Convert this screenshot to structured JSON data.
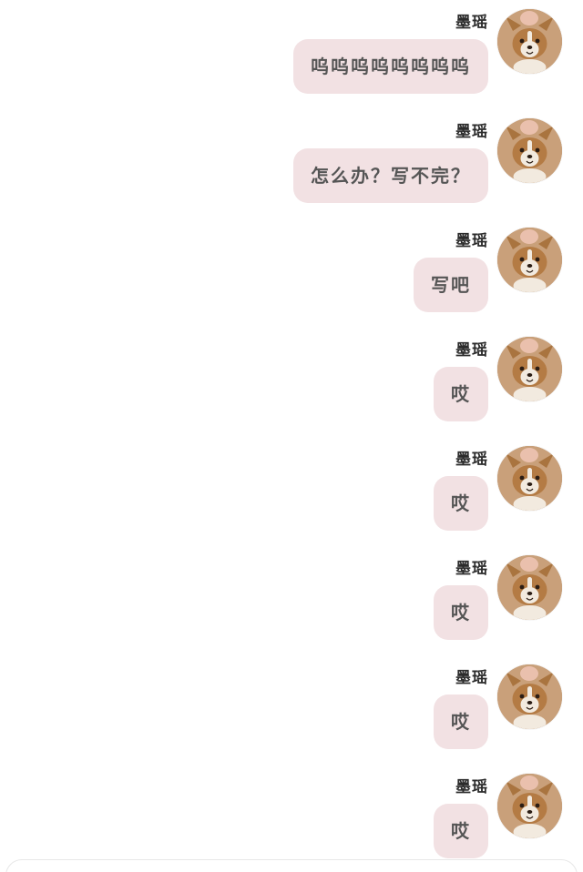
{
  "chat": {
    "messages": [
      {
        "sender": "墨瑶",
        "text": "呜呜呜呜呜呜呜呜"
      },
      {
        "sender": "墨瑶",
        "text": "怎么办？写不完？"
      },
      {
        "sender": "墨瑶",
        "text": "写吧"
      },
      {
        "sender": "墨瑶",
        "text": "哎"
      },
      {
        "sender": "墨瑶",
        "text": "哎"
      },
      {
        "sender": "墨瑶",
        "text": "哎"
      },
      {
        "sender": "墨瑶",
        "text": "哎"
      },
      {
        "sender": "墨瑶",
        "text": "哎"
      }
    ]
  },
  "colors": {
    "bubble": "#f2e1e3",
    "bubble_text": "#555555",
    "sender_text": "#2b2b2b"
  },
  "icons": {
    "avatar": "corgi-avatar-icon"
  }
}
